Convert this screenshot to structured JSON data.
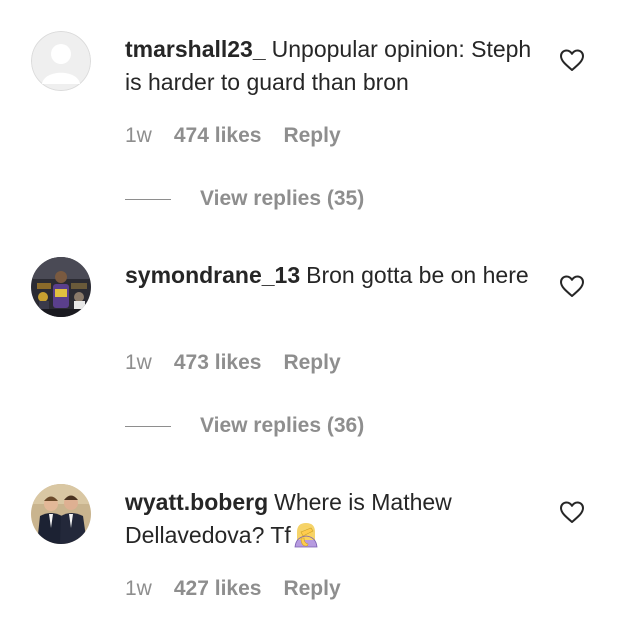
{
  "comments": [
    {
      "username": "tmarshall23_",
      "text": "Unpopular opinion: Steph is harder to guard than bron",
      "time": "1w",
      "likes": "474 likes",
      "reply": "Reply",
      "view_replies": "View replies (35)"
    },
    {
      "username": "symondrane_13",
      "text": "Bron gotta be on here",
      "time": "1w",
      "likes": "473 likes",
      "reply": "Reply",
      "view_replies": "View replies (36)"
    },
    {
      "username": "wyatt.boberg",
      "text": "Where is Mathew Dellavedova? Tf",
      "time": "1w",
      "likes": "427 likes",
      "reply": "Reply"
    }
  ],
  "icons": {
    "heart": "heart-outline-icon",
    "emoji": "woman-facepalming-emoji"
  },
  "colors": {
    "text": "#262626",
    "secondary": "#8e8e8e",
    "background": "#ffffff"
  }
}
